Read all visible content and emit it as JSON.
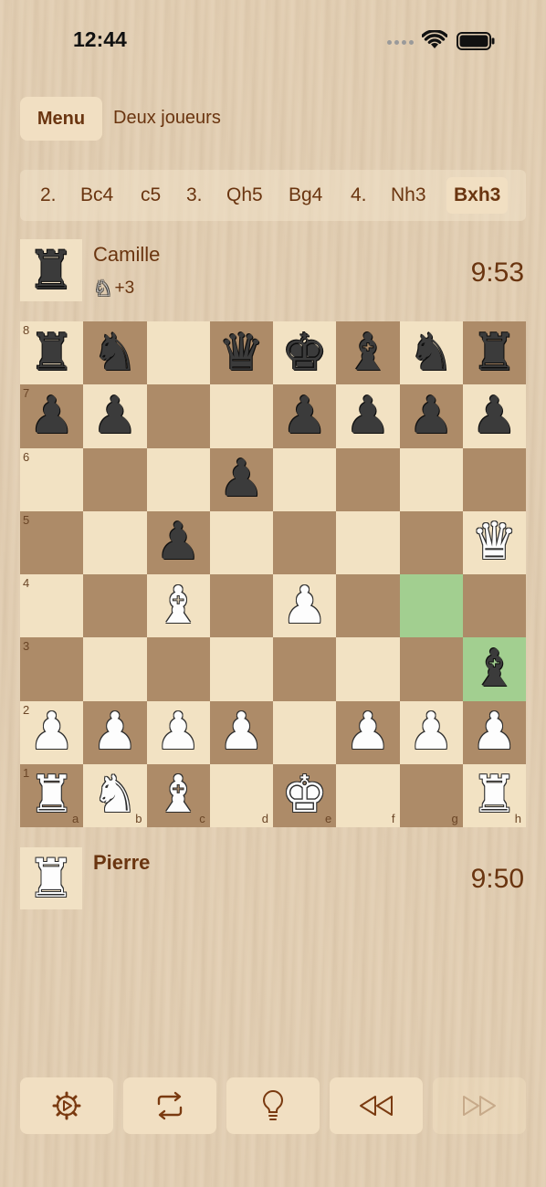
{
  "status_bar": {
    "time": "12:44"
  },
  "nav": {
    "menu_label": "Menu",
    "mode_title": "Deux joueurs"
  },
  "moves": [
    "2.",
    "Bc4",
    "c5",
    "3.",
    "Qh5",
    "Bg4",
    "4.",
    "Nh3",
    "Bxh3"
  ],
  "current_move_index": 8,
  "top_player": {
    "name": "Camille",
    "clock": "9:53",
    "captured_piece": "white-knight",
    "captured_glyph": "♘",
    "material_advantage": "+3"
  },
  "bottom_player": {
    "name": "Pierre",
    "clock": "9:50"
  },
  "board": {
    "ranks": [
      "8",
      "7",
      "6",
      "5",
      "4",
      "3",
      "2",
      "1"
    ],
    "files": [
      "a",
      "b",
      "c",
      "d",
      "e",
      "f",
      "g",
      "h"
    ],
    "rows": [
      [
        "br",
        "bn",
        "",
        "bq",
        "bk",
        "bb",
        "bn",
        "br"
      ],
      [
        "bp",
        "bp",
        "",
        "",
        "bp",
        "bp",
        "bp",
        "bp"
      ],
      [
        "",
        "",
        "",
        "bp",
        "",
        "",
        "",
        ""
      ],
      [
        "",
        "",
        "bp",
        "",
        "",
        "",
        "",
        "wq"
      ],
      [
        "",
        "",
        "wb",
        "",
        "wp",
        "",
        "",
        ""
      ],
      [
        "",
        "",
        "",
        "",
        "",
        "",
        "",
        "bb"
      ],
      [
        "wp",
        "wp",
        "wp",
        "wp",
        "",
        "wp",
        "wp",
        "wp"
      ],
      [
        "wr",
        "wn",
        "wb",
        "",
        "wk",
        "",
        "",
        "wr"
      ]
    ],
    "highlighted_squares": [
      "g4",
      "h3"
    ],
    "colors": {
      "light": "#f2e2c3",
      "dark": "#ad8b68",
      "highlight": "#a2cf90"
    }
  },
  "toolbar": [
    {
      "icon": "settings-icon",
      "enabled": true
    },
    {
      "icon": "flip-board-icon",
      "enabled": true
    },
    {
      "icon": "hint-lightbulb-icon",
      "enabled": true
    },
    {
      "icon": "rewind-icon",
      "enabled": true
    },
    {
      "icon": "fast-forward-icon",
      "enabled": false
    }
  ]
}
